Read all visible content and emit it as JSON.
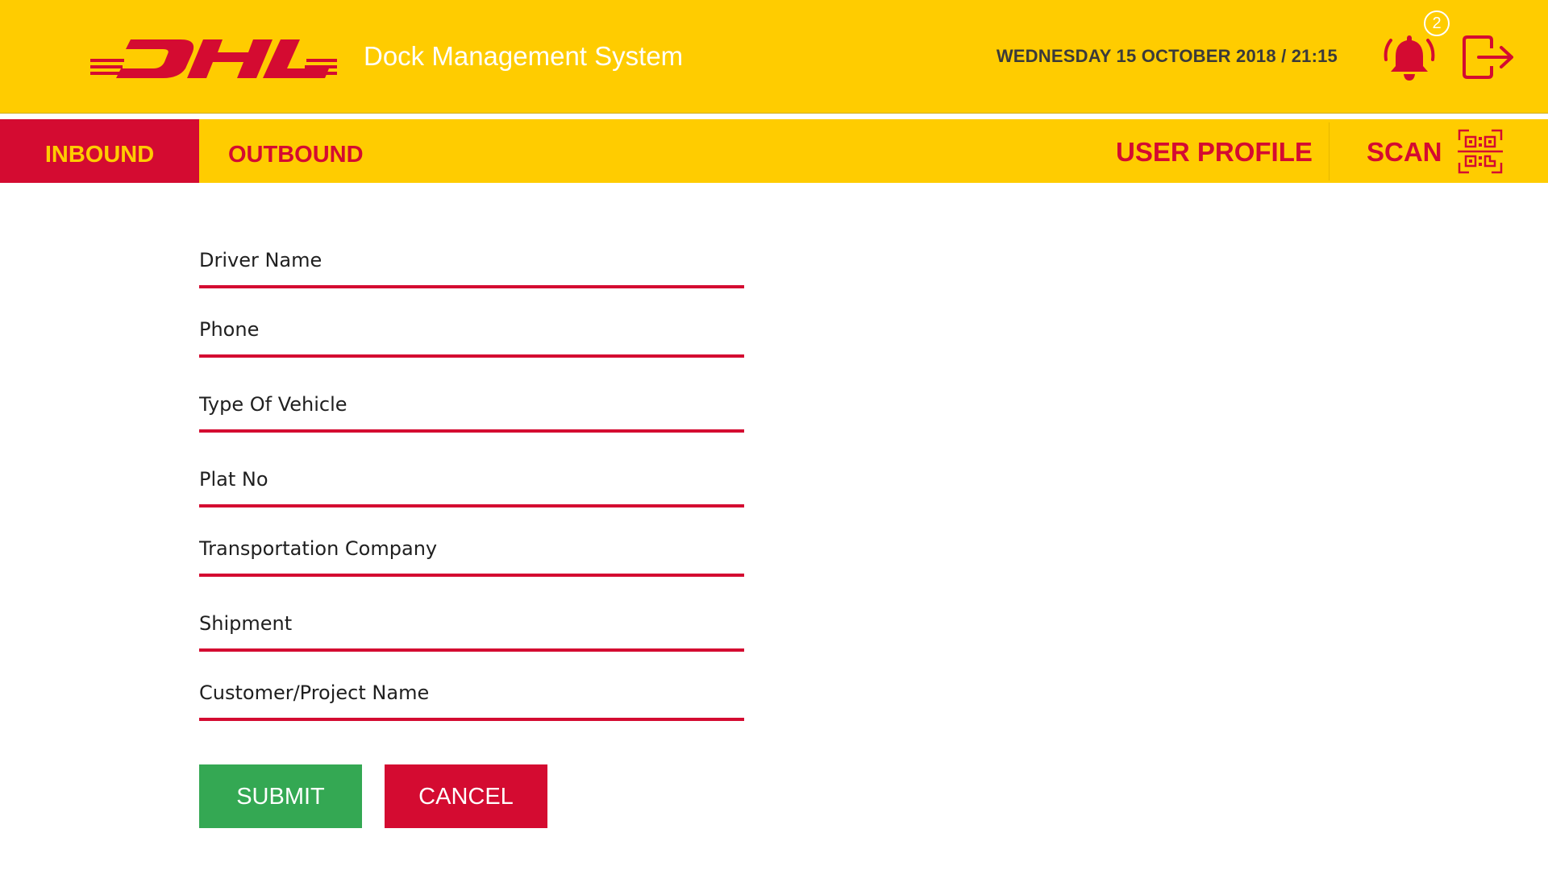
{
  "header": {
    "logo_text": "DHL",
    "app_title": "Dock Management System",
    "datetime": "WEDNESDAY 15 OCTOBER 2018 / 21:15",
    "notification_count": "2",
    "bell_icon": "bell-icon",
    "logout_icon": "logout-icon"
  },
  "nav": {
    "tabs": [
      {
        "label": "INBOUND",
        "active": true
      },
      {
        "label": "OUTBOUND",
        "active": false
      }
    ],
    "user_profile": "USER PROFILE",
    "scan": "SCAN",
    "scan_icon": "qr-code-icon"
  },
  "form": {
    "fields": [
      {
        "placeholder": "Driver Name",
        "value": ""
      },
      {
        "placeholder": "Phone",
        "value": ""
      },
      {
        "placeholder": "Type Of Vehicle",
        "value": ""
      },
      {
        "placeholder": "Plat No",
        "value": ""
      },
      {
        "placeholder": "Transportation Company",
        "value": ""
      },
      {
        "placeholder": "Shipment",
        "value": ""
      },
      {
        "placeholder": "Customer/Project Name",
        "value": ""
      }
    ],
    "submit_label": "SUBMIT",
    "cancel_label": "CANCEL"
  },
  "colors": {
    "brand_yellow": "#FFCC00",
    "brand_red": "#D40B31",
    "submit_green": "#34A853"
  }
}
